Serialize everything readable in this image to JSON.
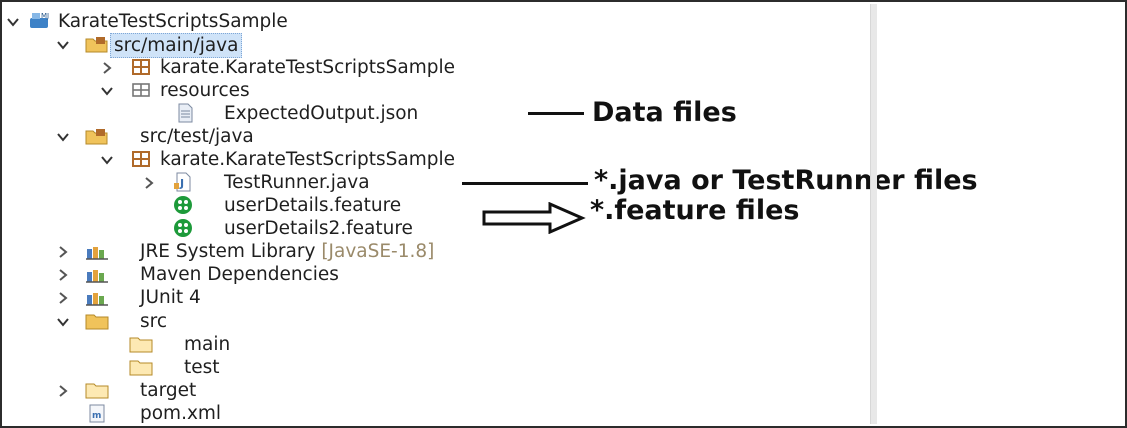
{
  "project": {
    "name": "KarateTestScriptsSample"
  },
  "main_src": {
    "name": "src/main/java"
  },
  "main_pkg": {
    "name": "karate.KarateTestScriptsSample"
  },
  "resources": {
    "name": "resources"
  },
  "expected_output": {
    "name": "ExpectedOutput.json"
  },
  "test_src": {
    "name": "src/test/java"
  },
  "test_pkg": {
    "name": "karate.KarateTestScriptsSample"
  },
  "test_runner": {
    "name": "TestRunner.java"
  },
  "feature1": {
    "name": "userDetails.feature"
  },
  "feature2": {
    "name": "userDetails2.feature"
  },
  "jre": {
    "name": "JRE System Library",
    "suffix": "[JavaSE-1.8]"
  },
  "maven": {
    "name": "Maven Dependencies"
  },
  "junit": {
    "name": "JUnit 4"
  },
  "src_folder": {
    "name": "src"
  },
  "main_folder": {
    "name": "main"
  },
  "test_folder": {
    "name": "test"
  },
  "target_folder": {
    "name": "target"
  },
  "pom": {
    "name": "pom.xml"
  },
  "annotations": {
    "data_files": "Data files",
    "java_files": "*.java or TestRunner files",
    "feature_files": "*.feature files"
  },
  "colors": {
    "selection": "#cfe3f8",
    "feature_icon": "#1d9a3a",
    "folder": "#f0c35b",
    "package": "#b06a2a"
  },
  "icons": [
    "chevron-down-icon",
    "chevron-right-icon",
    "project-icon",
    "source-folder-icon",
    "package-icon",
    "folder-icon",
    "json-file-icon",
    "java-file-icon",
    "cucumber-icon",
    "library-icon",
    "maven-file-icon"
  ]
}
